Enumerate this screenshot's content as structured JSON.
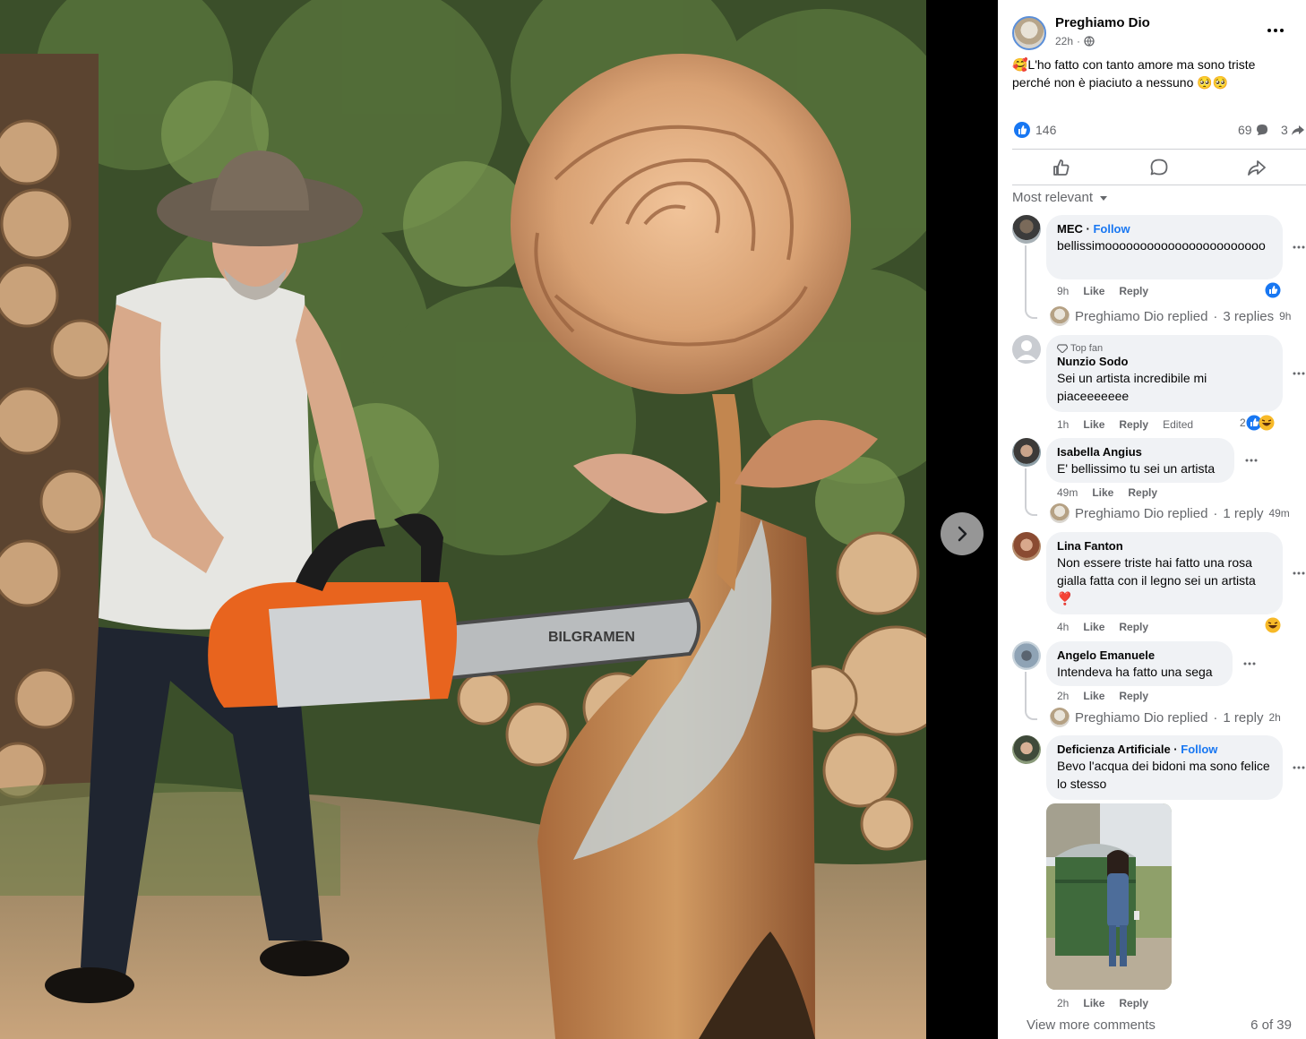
{
  "post": {
    "author": "Preghiamo Dio",
    "time": "22h",
    "text": "🥰L'ho fatto con tanto amore ma sono triste perché non è piaciuto a nessuno 🥺🥺",
    "likes": "146",
    "comments": "69",
    "shares": "3"
  },
  "photo": {
    "chainsaw_brand": "BILGRAMEN"
  },
  "sort_label": "Most relevant",
  "comments": [
    {
      "name": "MEC",
      "follow": "Follow",
      "text": "bellissimooooooooooooooooooooooo",
      "time": "9h",
      "like": "Like",
      "reply": "Reply",
      "replied_by": "Preghiamo Dio replied",
      "replies": "3 replies",
      "replied_time": "9h"
    },
    {
      "badge": "Top fan",
      "name": "Nunzio Sodo",
      "text": "Sei un artista incredibile mi piaceeeeeee",
      "time": "1h",
      "like": "Like",
      "reply": "Reply",
      "edited": "Edited",
      "reactions": "2"
    },
    {
      "name": "Isabella Angius",
      "text": "E' bellissimo tu sei un artista",
      "time": "49m",
      "like": "Like",
      "reply": "Reply",
      "replied_by": "Preghiamo Dio replied",
      "replies": "1 reply",
      "replied_time": "49m"
    },
    {
      "name": "Lina Fanton",
      "text": "Non essere triste hai fatto una rosa gialla fatta con il legno sei un artista ❣️",
      "time": "4h",
      "like": "Like",
      "reply": "Reply"
    },
    {
      "name": "Angelo Emanuele",
      "text": "Intendeva ha fatto una sega",
      "time": "2h",
      "like": "Like",
      "reply": "Reply",
      "replied_by": "Preghiamo Dio replied",
      "replies": "1 reply",
      "replied_time": "2h"
    },
    {
      "name": "Deficienza Artificiale",
      "follow": "Follow",
      "text": "Bevo l'acqua dei bidoni ma sono felice lo stesso",
      "time": "2h",
      "like": "Like",
      "reply": "Reply"
    }
  ],
  "view_more": "View more comments",
  "pager": "6 of 39"
}
